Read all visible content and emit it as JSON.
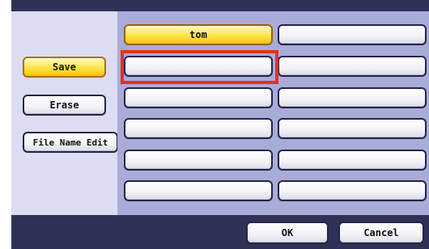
{
  "left_panel": {
    "save_label": "Save",
    "erase_label": "Erase",
    "file_name_edit_label": "File Name Edit"
  },
  "slots": [
    {
      "label": "tom",
      "selected": true
    },
    {
      "label": "",
      "selected": false
    },
    {
      "label": "",
      "selected": false
    },
    {
      "label": "",
      "selected": false
    },
    {
      "label": "",
      "selected": false
    },
    {
      "label": "",
      "selected": false
    },
    {
      "label": "",
      "selected": false
    },
    {
      "label": "",
      "selected": false
    },
    {
      "label": "",
      "selected": false
    },
    {
      "label": "",
      "selected": false
    },
    {
      "label": "",
      "selected": false
    },
    {
      "label": "",
      "selected": false
    }
  ],
  "footer": {
    "ok_label": "OK",
    "cancel_label": "Cancel"
  },
  "colors": {
    "frame": "#2f3256",
    "left_panel": "#dcdcf2",
    "right_panel": "#a9acd8",
    "selected": "#ffe24a",
    "highlight": "#e8301c"
  }
}
